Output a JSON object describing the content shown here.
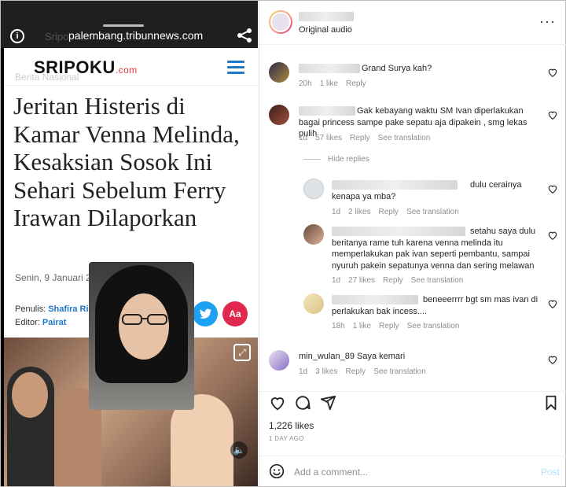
{
  "video": {
    "url": "palembang.tribunnews.com",
    "ghost_title": "Sripo",
    "site_logo": "SRIPOKU",
    "site_logo_suffix": ".com",
    "ghost_category": "Berita Nasional",
    "headline": "Jeritan Histeris di Kamar Venna Melinda, Kesaksian Sosok Ini Sehari Sebelum Ferry Irawan Dilaporkan",
    "date": "Senin, 9 Januari 2023 14:34",
    "writer_label": "Penulis:",
    "writer_name": "Shafira Rianiesti Noor",
    "editor_label": "Editor:",
    "editor_name": "Pairat",
    "share_text_label": "Aa",
    "colors": {
      "twitter": "#1da1f2",
      "font_btn": "#e0284f",
      "facebook": "#3b5998"
    },
    "icons": [
      "info-icon",
      "share-icon",
      "menu-icon",
      "play-icon",
      "tiktok-icon",
      "expand-icon",
      "volume-icon"
    ]
  },
  "post": {
    "audio_label": "Original audio",
    "comments": [
      {
        "text": "Grand Surya kah?",
        "time": "20h",
        "likes": "1 like",
        "reply": "Reply",
        "translate": ""
      },
      {
        "text": "Gak kebayang waktu SM Ivan diperlakukan bagai princess sampe pake sepatu aja dipakein , smg lekas pulih",
        "time": "1d",
        "likes": "57 likes",
        "reply": "Reply",
        "translate": "See translation"
      }
    ],
    "hide_replies": "Hide replies",
    "replies": [
      {
        "text": "dulu cerainya kenapa ya mba?",
        "time": "1d",
        "likes": "2 likes",
        "reply": "Reply",
        "translate": "See translation"
      },
      {
        "text": "setahu saya dulu beritanya rame tuh karena venna melinda itu memperlakukan pak ivan seperti pembantu, sampai nyuruh pakein sepatunya venna dan sering melawan",
        "time": "1d",
        "likes": "27 likes",
        "reply": "Reply",
        "translate": "See translation"
      },
      {
        "text": "beneeerrrr bgt sm mas ivan di perlakukan bak incess....",
        "time": "18h",
        "likes": "1 like",
        "reply": "Reply",
        "translate": "See translation"
      }
    ],
    "last_comment": {
      "username": "min_wulan_89",
      "text": "Saya kemari",
      "time": "1d",
      "likes": "3 likes",
      "reply": "Reply",
      "translate": "See translation"
    },
    "likes_count": "1,226 likes",
    "posted_ago": "1 DAY AGO",
    "add_comment_placeholder": "Add a comment...",
    "post_button": "Post",
    "icons": [
      "heart-icon",
      "comment-icon",
      "send-icon",
      "bookmark-icon",
      "emoji-icon",
      "more-icon"
    ]
  }
}
